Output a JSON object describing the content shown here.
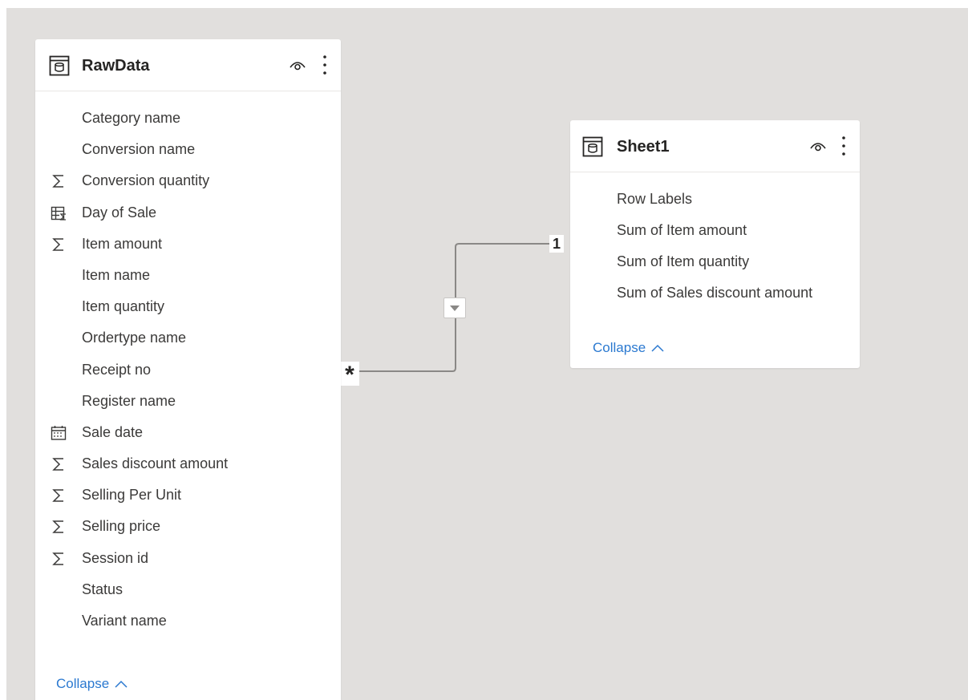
{
  "tables": {
    "rawdata": {
      "title": "RawData",
      "icon": "table-icon",
      "fields": [
        {
          "label": "Category name",
          "icon": ""
        },
        {
          "label": "Conversion name",
          "icon": ""
        },
        {
          "label": "Conversion quantity",
          "icon": "sigma-icon"
        },
        {
          "label": "Day of Sale",
          "icon": "calculated-column-icon"
        },
        {
          "label": "Item amount",
          "icon": "sigma-icon"
        },
        {
          "label": "Item name",
          "icon": ""
        },
        {
          "label": "Item quantity",
          "icon": ""
        },
        {
          "label": "Ordertype name",
          "icon": ""
        },
        {
          "label": "Receipt no",
          "icon": ""
        },
        {
          "label": "Register name",
          "icon": ""
        },
        {
          "label": "Sale date",
          "icon": "calendar-icon"
        },
        {
          "label": "Sales discount amount",
          "icon": "sigma-icon"
        },
        {
          "label": "Selling Per Unit",
          "icon": "sigma-icon"
        },
        {
          "label": "Selling price",
          "icon": "sigma-icon"
        },
        {
          "label": "Session id",
          "icon": "sigma-icon"
        },
        {
          "label": "Status",
          "icon": ""
        },
        {
          "label": "Variant name",
          "icon": ""
        }
      ],
      "collapse_label": "Collapse"
    },
    "sheet1": {
      "title": "Sheet1",
      "icon": "table-icon",
      "fields": [
        {
          "label": "Row Labels",
          "icon": ""
        },
        {
          "label": "Sum of Item amount",
          "icon": ""
        },
        {
          "label": "Sum of Item quantity",
          "icon": ""
        },
        {
          "label": "Sum of Sales discount amount",
          "icon": ""
        }
      ],
      "collapse_label": "Collapse"
    }
  },
  "relationship": {
    "from_table": "RawData",
    "to_table": "Sheet1",
    "from_cardinality": "*",
    "to_cardinality": "1",
    "filter_icon": "triangle-down-icon"
  },
  "colors": {
    "canvas": "#e1dfdd",
    "card": "#ffffff",
    "link": "#2b79d0",
    "line": "#8a8886"
  }
}
